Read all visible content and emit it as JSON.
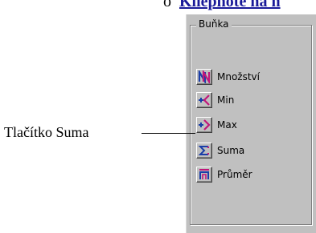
{
  "heading": {
    "bullet": "o",
    "text": "Kliepnote na n"
  },
  "panel": {
    "group_title": "Buňka",
    "items": [
      {
        "label": "Množství",
        "icon": "count-icon"
      },
      {
        "label": "Min",
        "icon": "min-icon"
      },
      {
        "label": "Max",
        "icon": "max-icon"
      },
      {
        "label": "Suma",
        "icon": "sum-icon"
      },
      {
        "label": "Průměr",
        "icon": "average-icon"
      }
    ]
  },
  "annotation": {
    "text": "Tlačítko Suma"
  },
  "colors": {
    "panel_bg": "#c0c0c0",
    "icon_magenta": "#c0167a",
    "icon_blue": "#1a3ea8",
    "heading": "#1a1a99"
  }
}
